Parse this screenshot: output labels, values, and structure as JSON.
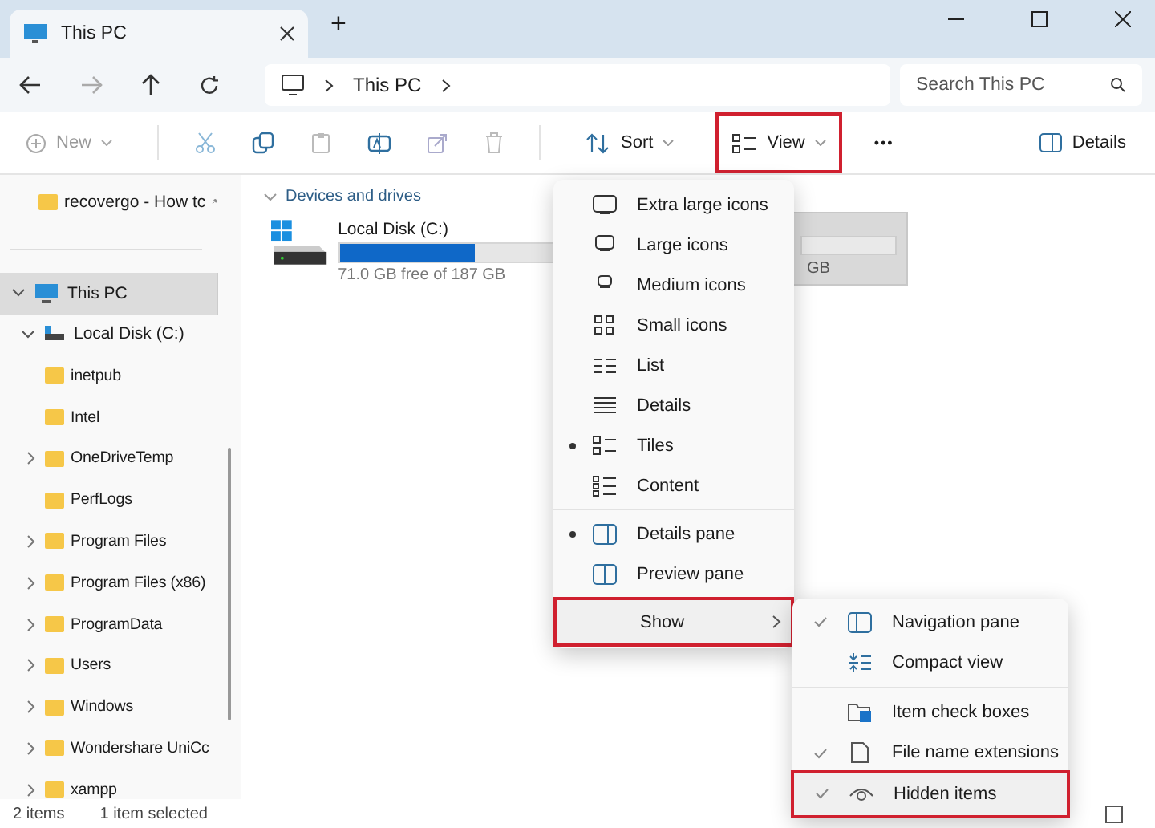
{
  "window": {
    "tab_title": "This PC",
    "new_tab": "+"
  },
  "address": {
    "path": "This PC",
    "search": {
      "placeholder": "Search This PC"
    }
  },
  "toolbar": {
    "new": "New",
    "sort": "Sort",
    "view": {
      "label": "View",
      "highlighted": true
    },
    "more": "•••",
    "details": "Details"
  },
  "sidebar": {
    "pinned": [
      {
        "label": "recovergo - How tc"
      }
    ],
    "items": [
      {
        "label": "This PC",
        "expanded": true,
        "selected": true,
        "children": [
          {
            "label": "Local Disk (C:)",
            "expanded": true,
            "selected": false,
            "children": [
              {
                "label": "inetpub",
                "expandable": false
              },
              {
                "label": "Intel",
                "expandable": false
              },
              {
                "label": "OneDriveTemp",
                "expandable": true
              },
              {
                "label": "PerfLogs",
                "expandable": false
              },
              {
                "label": "Program Files",
                "expandable": true
              },
              {
                "label": "Program Files (x86)",
                "expandable": true
              },
              {
                "label": "ProgramData",
                "expandable": true
              },
              {
                "label": "Users",
                "expandable": true
              },
              {
                "label": "Windows",
                "expandable": true
              },
              {
                "label": "Wondershare UniCc",
                "expandable": true
              },
              {
                "label": "xampp",
                "expandable": true
              }
            ]
          }
        ]
      }
    ]
  },
  "content": {
    "section": "Devices and drives",
    "drives": [
      {
        "name": "Local Disk (C:)",
        "level": 0.62,
        "free": "71.0 GB free of 187 GB",
        "selected": false
      },
      {
        "free": "GB",
        "selected": true
      }
    ]
  },
  "view_menu": {
    "sections": [
      [
        {
          "label": "Extra large icons",
          "selected": false
        },
        {
          "label": "Large icons",
          "selected": false
        },
        {
          "label": "Medium icons",
          "selected": false
        },
        {
          "label": "Small icons",
          "selected": false
        },
        {
          "label": "List",
          "selected": false
        },
        {
          "label": "Details",
          "selected": false
        },
        {
          "label": "Tiles",
          "selected": true
        },
        {
          "label": "Content",
          "selected": false
        }
      ],
      [
        {
          "label": "Details pane",
          "selected": true
        },
        {
          "label": "Preview pane",
          "selected": false
        }
      ]
    ],
    "show": {
      "label": "Show",
      "highlighted": true
    }
  },
  "show_menu": {
    "sections": [
      [
        {
          "label": "Navigation pane",
          "checked": true,
          "highlighted": false
        },
        {
          "label": "Compact view",
          "checked": false,
          "highlighted": false
        }
      ],
      [
        {
          "label": "Item check boxes",
          "checked": false,
          "highlighted": false
        },
        {
          "label": "File name extensions",
          "checked": true,
          "highlighted": false
        },
        {
          "label": "Hidden items",
          "checked": true,
          "highlighted": true
        }
      ]
    ]
  },
  "status_bar": {
    "count": "2 items",
    "selection": "1 item selected"
  }
}
